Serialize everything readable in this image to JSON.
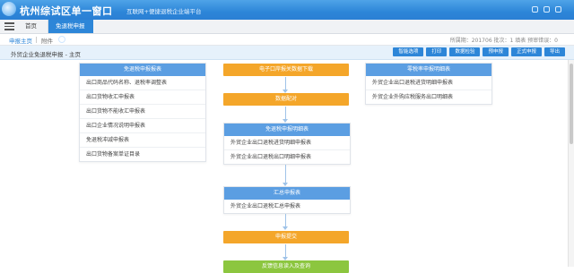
{
  "header": {
    "title": "杭州综试区单一窗口",
    "subtitle": "互联网+便捷退税企业端平台"
  },
  "nav": {
    "home_tab": "首页",
    "active_tab": "免退税申报"
  },
  "subtabs": {
    "first": "申报主页",
    "second": "附件",
    "meta": "所属期：201706  批次：1  填表  预审错误：0"
  },
  "toolbar": {
    "breadcrumb": "外贸企业免退税申报 - 主页",
    "buttons": [
      "智能选项",
      "打印",
      "数据检验",
      "预申报",
      "正式申报",
      "导出"
    ]
  },
  "cards": {
    "left": {
      "title": "免退税申报报表",
      "items": [
        "出口商品代码名称、退税率调整表",
        "出口货物收汇申报表",
        "出口货物不能收汇申报表",
        "出口企业情况说明申报表",
        "免退税冲减申报表",
        "出口货物备案单证目录"
      ]
    },
    "center_top": {
      "title": "电子口岸报关数据下载"
    },
    "center_mid": {
      "title": "数据配对"
    },
    "center_detail": {
      "title": "免退税申报明细表",
      "items": [
        "外贸企业出口退税进货明细申报表",
        "外贸企业出口退税出口明细申报表"
      ]
    },
    "center_summary": {
      "title": "汇总申报表",
      "items": [
        "外贸企业出口退税汇总申报表"
      ]
    },
    "center_submit": {
      "title": "申报提交"
    },
    "center_bottom": {
      "title": "反馈信息读入及查询"
    },
    "right": {
      "title": "零税率申报明细表",
      "items": [
        "外贸企业出口退税进货明细申报表",
        "外贸企业外购应税服务出口明细表"
      ]
    }
  },
  "colors": {
    "header": "#2d86d8",
    "card_blue": "#5b9ee2",
    "card_orange": "#f4a62a",
    "card_green": "#8cc63f"
  }
}
